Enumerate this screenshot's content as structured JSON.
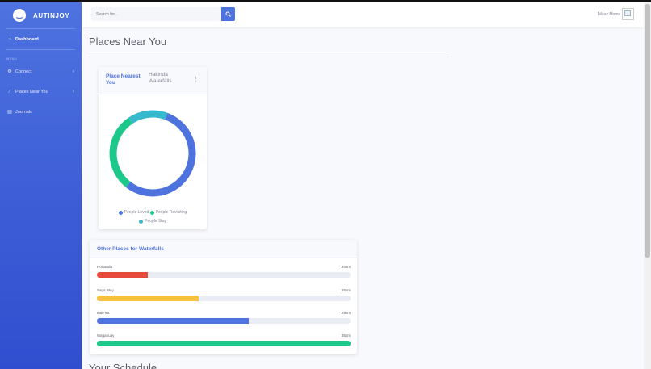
{
  "sidebar": {
    "brand": "AUTINJOY",
    "items": [
      {
        "label": "Dashboard",
        "icon": "dashboard-icon"
      },
      {
        "label": "Connect",
        "icon": "gear-icon"
      },
      {
        "label": "Places Near You",
        "icon": "wrench-icon"
      },
      {
        "label": "Journals",
        "icon": "chart-icon"
      }
    ],
    "menu_heading": "MENU"
  },
  "topbar": {
    "search_placeholder": "Search for...",
    "user_name": "Maaz Moms"
  },
  "main": {
    "page_title": "Places Near You",
    "next_section_heading": "Your Schedule"
  },
  "nearest_card": {
    "title": "Place Nearest You",
    "place": "Hakinda Waterfalls",
    "legend": [
      {
        "label": "People Loved",
        "color": "#4e73df"
      },
      {
        "label": "People Revisiting",
        "color": "#1cc88a"
      },
      {
        "label": "People Stay",
        "color": "#36b9cc"
      }
    ]
  },
  "chart_data": {
    "type": "pie",
    "categories": [
      "People Loved",
      "People Revisiting",
      "People Stay"
    ],
    "values": [
      55,
      30,
      15
    ],
    "colors": [
      "#4e73df",
      "#1cc88a",
      "#36b9cc"
    ],
    "legend": "bottom"
  },
  "others_card": {
    "title": "Other Places for Waterfalls",
    "places": [
      {
        "name": "Hoikanda",
        "distance": "20km",
        "progress": 0.2,
        "color": "#e74a3b"
      },
      {
        "name": "Saga Way",
        "distance": "25km",
        "progress": 0.4,
        "color": "#f6c23e"
      },
      {
        "name": "Inde Int.",
        "distance": "29km",
        "progress": 0.6,
        "color": "#4e73df"
      },
      {
        "name": "Waganuay",
        "distance": "35km",
        "progress": 1.0,
        "color": "#1cc88a"
      }
    ]
  }
}
